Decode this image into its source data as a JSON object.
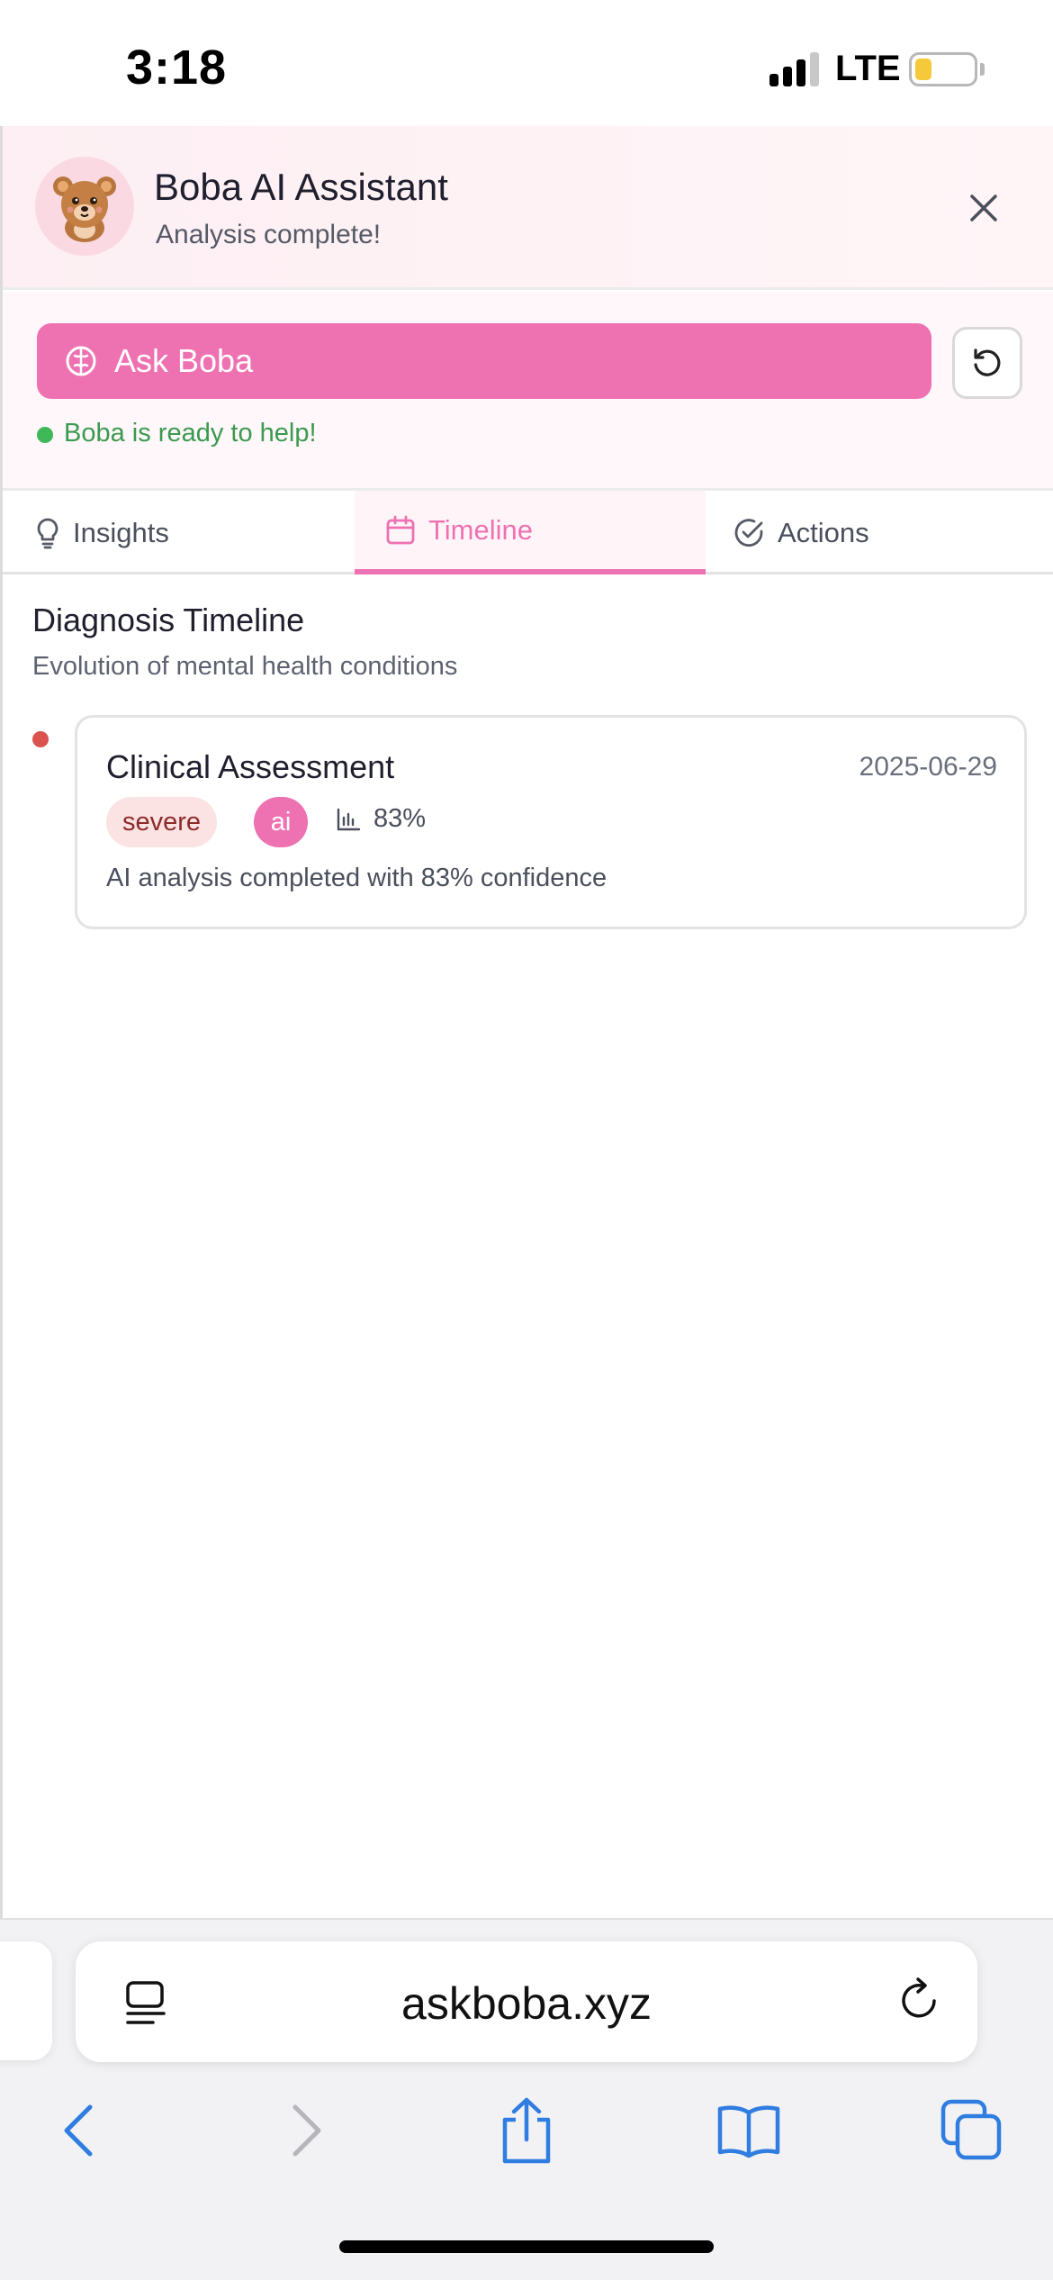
{
  "status_bar": {
    "time": "3:18",
    "network": "LTE"
  },
  "assistant": {
    "title": "Boba AI Assistant",
    "subtitle": "Analysis complete!",
    "ask_button": "Ask Boba",
    "ready_status": "Boba is ready to help!"
  },
  "tabs": [
    {
      "label": "Insights",
      "icon": "lightbulb-icon",
      "active": false
    },
    {
      "label": "Timeline",
      "icon": "calendar-icon",
      "active": true
    },
    {
      "label": "Actions",
      "icon": "check-circle-icon",
      "active": false
    }
  ],
  "timeline": {
    "title": "Diagnosis Timeline",
    "subtitle": "Evolution of mental health conditions",
    "entries": [
      {
        "title": "Clinical Assessment",
        "date": "2025-06-29",
        "severity": "severe",
        "source": "ai",
        "confidence": "83%",
        "description": "AI analysis completed with 83% confidence"
      }
    ]
  },
  "browser": {
    "url": "askboba.xyz"
  },
  "colors": {
    "accent": "#ee72b2",
    "ready": "#3fb85a",
    "severe_dot": "#d9534f",
    "ios_blue": "#2f7de1"
  }
}
